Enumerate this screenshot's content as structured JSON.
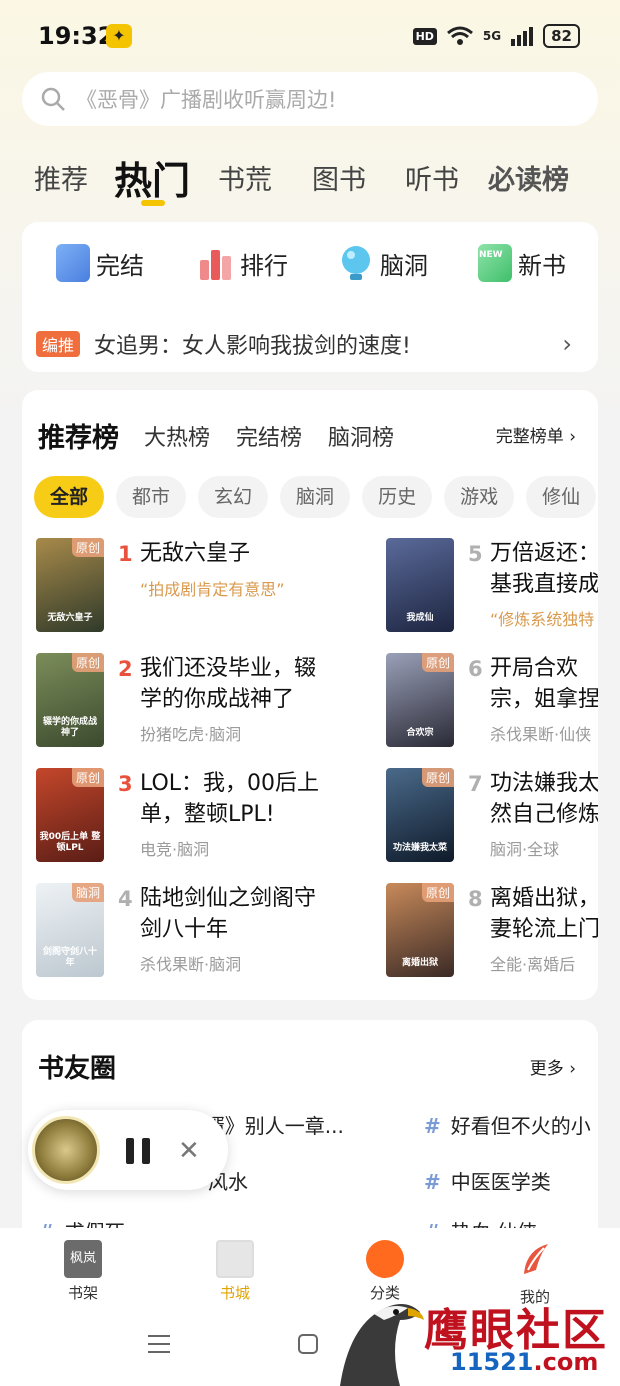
{
  "status_bar": {
    "time": "19:32",
    "hd": "HD",
    "network": "5G",
    "battery": "82"
  },
  "search": {
    "placeholder": "《恶骨》广播剧收听赢周边!"
  },
  "tabs": [
    "推荐",
    "热门",
    "书荒",
    "图书",
    "听书",
    "必读榜"
  ],
  "quick_links": [
    "完结",
    "排行",
    "脑洞",
    "新书"
  ],
  "quick_new_badge": "NEW",
  "editor_pick": {
    "badge": "编推",
    "text": "女追男：女人影响我拔剑的速度!"
  },
  "ranking": {
    "title": "推荐榜",
    "tabs": [
      "大热榜",
      "完结榜",
      "脑洞榜"
    ],
    "more": "完整榜单",
    "chips": [
      "全部",
      "都市",
      "玄幻",
      "脑洞",
      "历史",
      "游戏",
      "修仙"
    ],
    "books": [
      {
        "rank": "1",
        "title": "无敌六皇子",
        "sub": "“拍成剧肯定有意思”",
        "tag": "原创",
        "cover_text": "无敌六皇子"
      },
      {
        "rank": "2",
        "title": "我们还没毕业，辍学的你成战神了",
        "sub": "扮猪吃虎·脑洞",
        "tag": "原创",
        "cover_text": "辍学的你成战神了"
      },
      {
        "rank": "3",
        "title": "LOL：我，00后上单，整顿LPL!",
        "sub": "电竞·脑洞",
        "tag": "原创",
        "cover_text": "我00后上单 整顿LPL"
      },
      {
        "rank": "4",
        "title": "陆地剑仙之剑阁守剑八十年",
        "sub": "杀伐果断·脑洞",
        "tag": "脑洞",
        "cover_text": "剑阁守剑八十年"
      },
      {
        "rank": "5",
        "title": "万倍返还：基我直接成",
        "sub": "“修炼系统独特",
        "tag": "",
        "cover_text": "我成仙"
      },
      {
        "rank": "6",
        "title": "开局合欢宗，姐拿捏命脉",
        "sub": "杀伐果断·仙侠",
        "tag": "原创",
        "cover_text": "合欢宗"
      },
      {
        "rank": "7",
        "title": "功法嫌我太然自己修炼",
        "sub": "脑洞·全球",
        "tag": "原创",
        "cover_text": "功法嫌我太菜"
      },
      {
        "rank": "8",
        "title": "离婚出狱，妻轮流上门",
        "sub": "全能·离婚后",
        "tag": "原创",
        "cover_text": "离婚出狱"
      }
    ]
  },
  "friends": {
    "title": "书友圈",
    "more": "更多",
    "posts_left": [
      "《女神的超级赘婿》别人一章...",
      "风水",
      "求假死"
    ],
    "posts_right": [
      "好看但不火的小",
      "中医医学类",
      "热血·仙侠"
    ]
  },
  "bottom_nav": [
    "书架",
    "书城",
    "分类",
    "我的"
  ],
  "bottom_nav_shelf_icon_text": "枫岚",
  "watermark": {
    "name": "鹰眼社区",
    "url_num": "11521",
    "url_dom": ".com"
  },
  "colors": {
    "accent": "#f7cc17",
    "rank_red": "#e8513c",
    "rank_gray": "#b0b0b0",
    "sub_orange": "#d99a4e",
    "sub_gray": "#9a9a9a"
  }
}
